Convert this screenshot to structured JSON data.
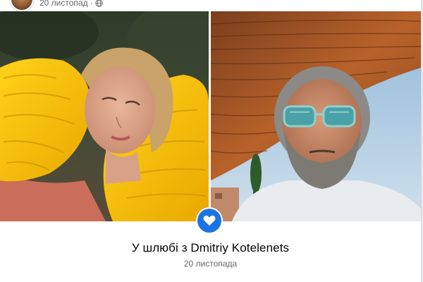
{
  "post": {
    "date": "20 листопад",
    "separator": "·",
    "privacy_icon": "globe-icon"
  },
  "life_event": {
    "icon": "heart-icon",
    "title": "У шлюбі з Dmitriy Kotelenets",
    "date": "20 листопада"
  },
  "photos": [
    {
      "name": "photo-woman-yellow-dress"
    },
    {
      "name": "photo-man-sunglasses-selfie"
    }
  ],
  "colors": {
    "accent": "#1b74e4",
    "text_primary": "#050505",
    "text_secondary": "#65676b"
  }
}
